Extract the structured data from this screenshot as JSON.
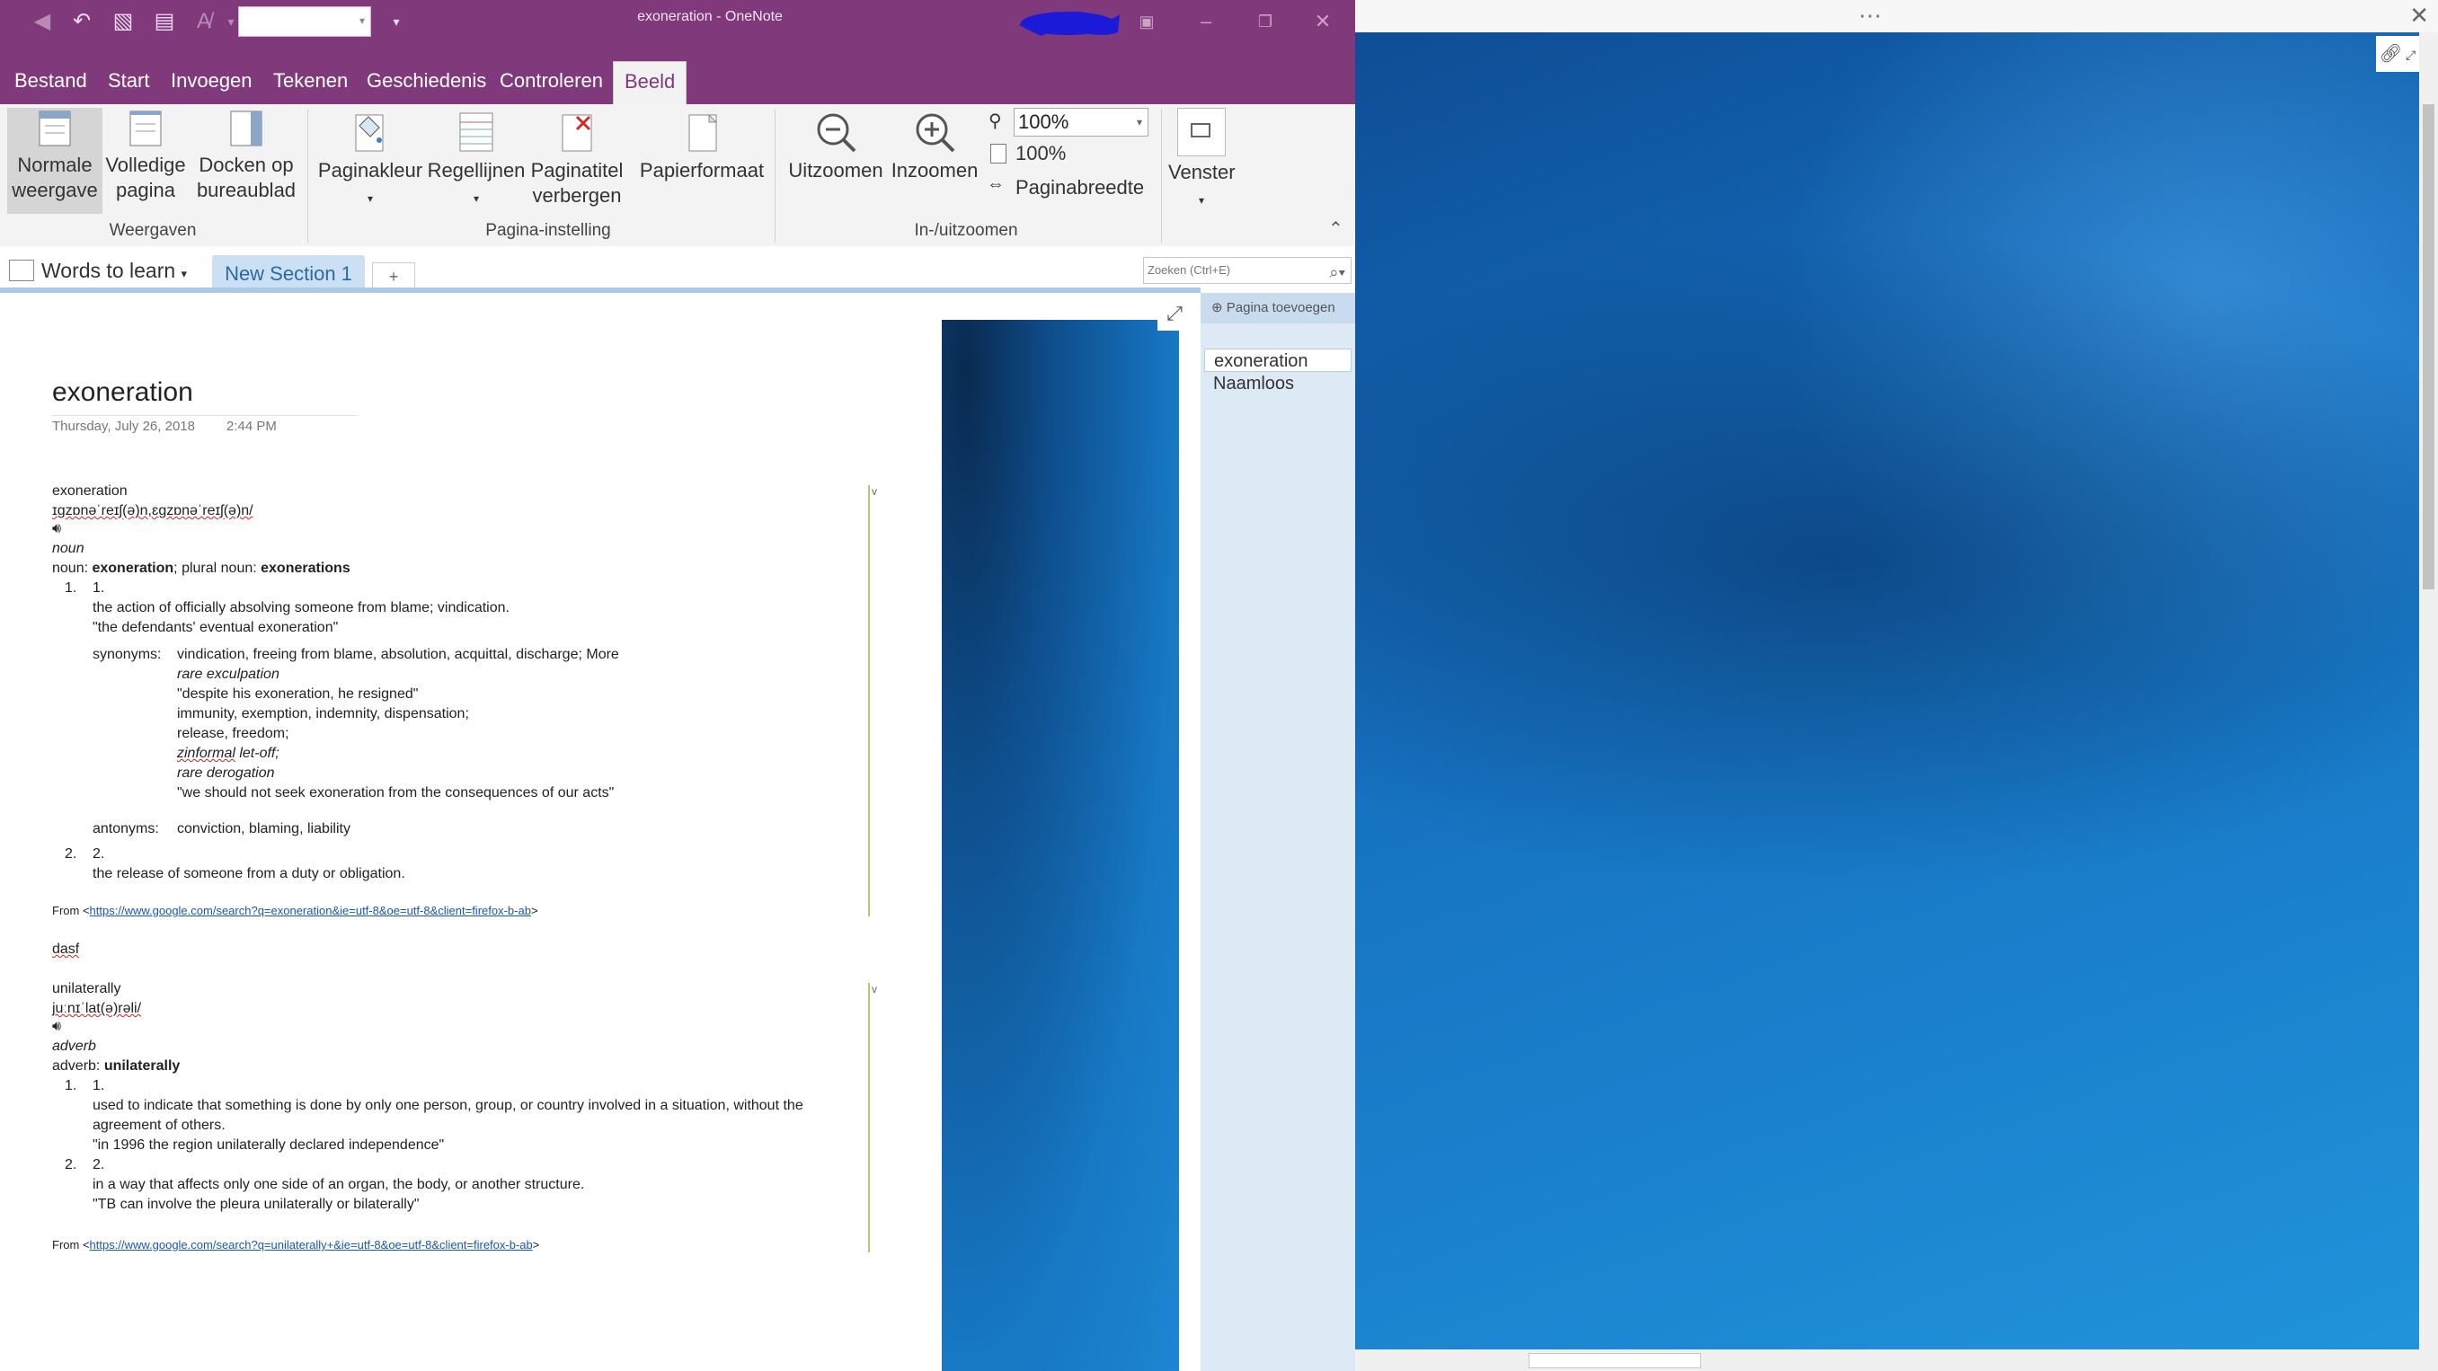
{
  "window": {
    "title": "exoneration - OneNote"
  },
  "ribbon_tabs": [
    "Bestand",
    "Start",
    "Invoegen",
    "Tekenen",
    "Geschiedenis",
    "Controleren",
    "Beeld"
  ],
  "ribbon": {
    "views": {
      "normal": [
        "Normale",
        "weergave"
      ],
      "full": [
        "Volledige",
        "pagina"
      ],
      "dock": [
        "Docken op",
        "bureaublad"
      ],
      "group": "Weergaven"
    },
    "page_setup": {
      "color": "Paginakleur",
      "rules": "Regellijnen",
      "hide_title": [
        "Paginatitel",
        "verbergen"
      ],
      "paper": "Papierformaat",
      "group": "Pagina-instelling"
    },
    "zoom": {
      "out": "Uitzoomen",
      "in": "Inzoomen",
      "combo": "100%",
      "hundred": "100%",
      "page_width": "Paginabreedte",
      "group": "In-/uitzoomen"
    },
    "window_btn": "Venster"
  },
  "notebook": {
    "name": "Words to learn",
    "section": "New Section 1",
    "add_section": "+",
    "search_placeholder": "Zoeken (Ctrl+E)"
  },
  "page": {
    "title": "exoneration",
    "date": "Thursday, July 26, 2018",
    "time": "2:44 PM",
    "entry1": {
      "word": "exoneration",
      "pron": "ɪɡzɒnəˈreɪʃ(ə)n,ɛɡzɒnəˈreɪʃ(ə)n/",
      "pos": "noun",
      "forms_prefix": "noun: ",
      "forms_word": "exoneration",
      "forms_mid": "; plural noun: ",
      "forms_plural": "exonerations",
      "num1_outer": "1.",
      "num1_inner": "1.",
      "def1": "the action of officially absolving someone from blame; vindication.",
      "ex1": "\"the defendants' eventual exoneration\"",
      "syn_label": "synonyms:",
      "syn_lines": [
        "vindication, freeing from blame, absolution, acquittal, discharge; More"
      ],
      "syn_rare": "rare exculpation",
      "syn_ex": "\"despite his exoneration, he resigned\"",
      "syn_l2": "immunity, exemption, indemnity, dispensation;",
      "syn_l3": "release, freedom;",
      "syn_inf_a": "zinformal",
      "syn_inf_b": " let-off;",
      "syn_rare2": "rare derogation",
      "syn_ex2": "\"we should not seek exoneration from the consequences of our acts\"",
      "ant_label": "antonyms:",
      "ant": "conviction, blaming, liability",
      "num2_outer": "2.",
      "num2_inner": "2.",
      "def2": "the release of someone from a duty or obligation.",
      "from": "From <",
      "url": "https://www.google.com/search?q=exoneration&ie=utf-8&oe=utf-8&client=firefox-b-ab",
      "from_end": ">"
    },
    "stray": "dasf",
    "entry2": {
      "word": "unilaterally",
      "pron": "juːnɪˈlat(ə)rəli/",
      "pos": "adverb",
      "forms_prefix": "adverb: ",
      "forms_word": "unilaterally",
      "num1_outer": "1.",
      "num1_inner": "1.",
      "def1a": "used to indicate that something is done by only one person, group, or country involved in a situation, without the",
      "def1b": "agreement of others.",
      "ex1": "\"in 1996 the region unilaterally declared independence\"",
      "num2_outer": "2.",
      "num2_inner": "2.",
      "def2": "in a way that affects only one side of an organ, the body, or another structure.",
      "ex2": "\"TB can involve the pleura unilaterally or bilaterally\"",
      "from": "From <",
      "url": "https://www.google.com/search?q=unilaterally+&ie=utf-8&oe=utf-8&client=firefox-b-ab",
      "from_end": ">"
    },
    "collapse_marker": "v"
  },
  "page_list": {
    "add_page": "Pagina toevoegen",
    "pages": [
      "exoneration",
      "Naamloos"
    ]
  },
  "colors": {
    "onenote_purple": "#80397b",
    "section_blue": "#cce0f3",
    "page_list_bg": "#dde9f5",
    "outline_bar": "#b6c774"
  }
}
